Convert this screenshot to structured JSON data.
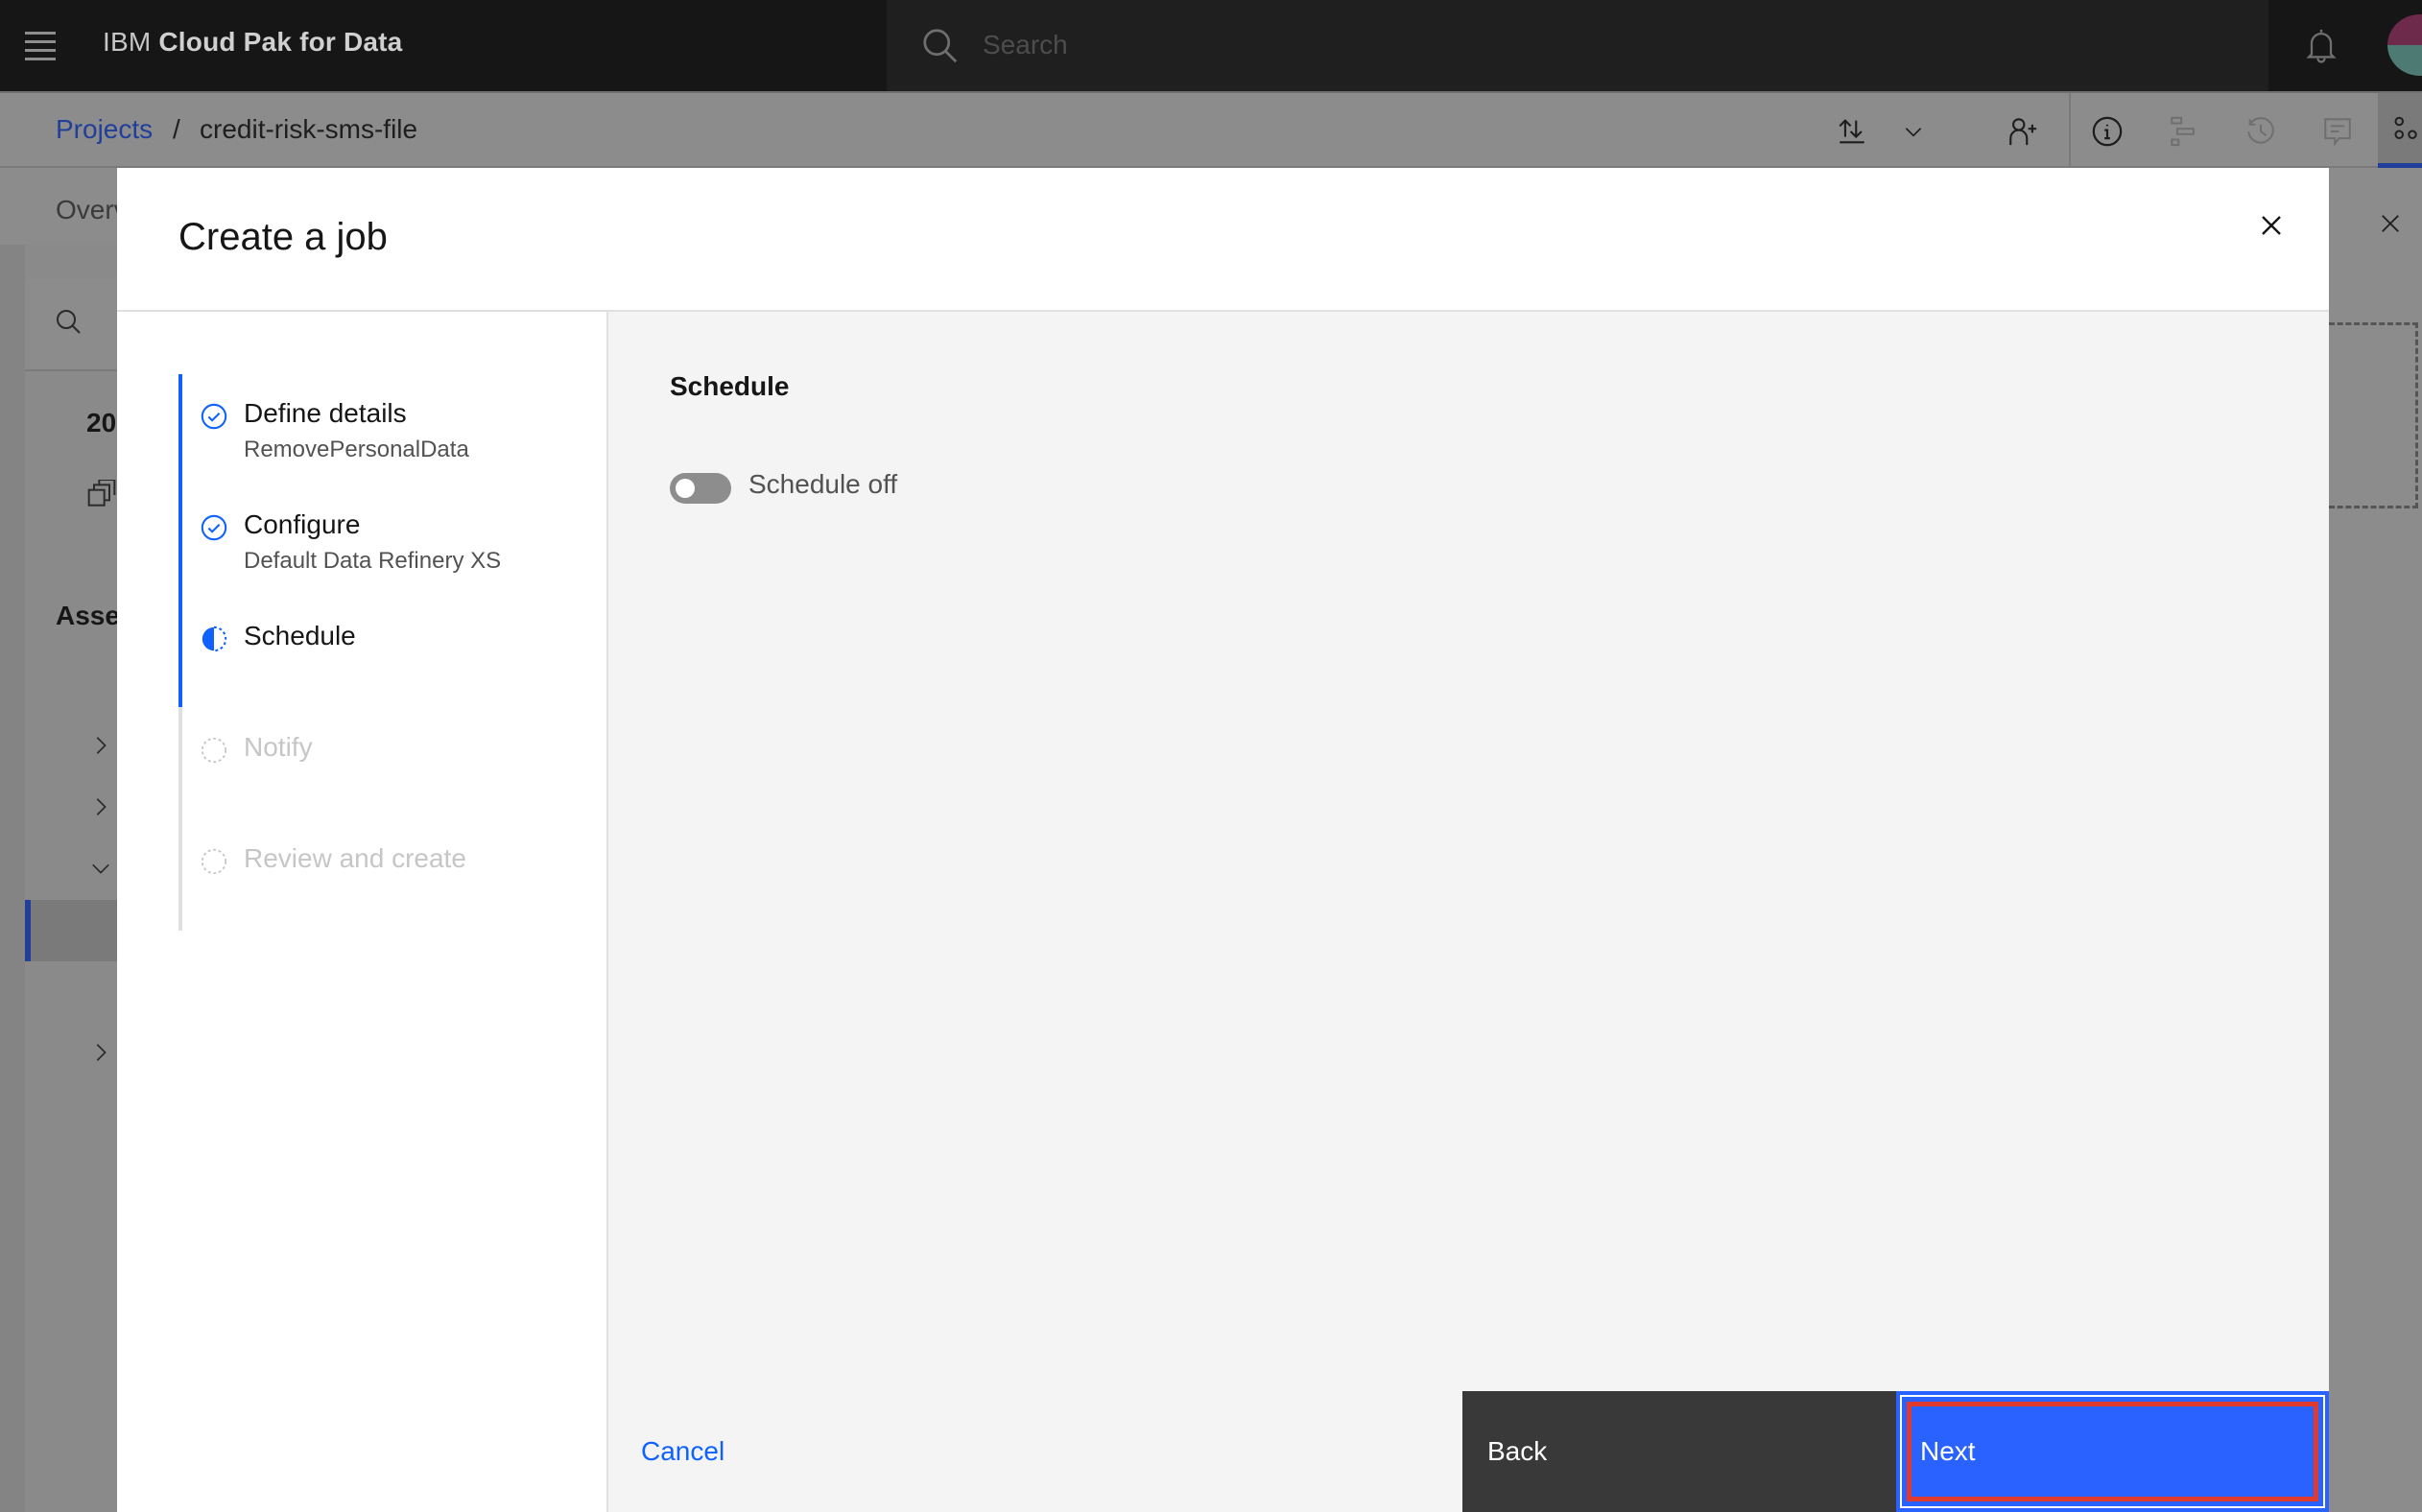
{
  "header": {
    "brand_prefix": "IBM",
    "brand_name": "Cloud Pak for Data",
    "search_placeholder": "Search",
    "icons": [
      "menu-icon",
      "search-icon",
      "notification-bell-icon",
      "user-avatar"
    ]
  },
  "breadcrumb": {
    "root": "Projects",
    "separator": "/",
    "current": "credit-risk-sms-file"
  },
  "toolbar": {
    "icons": [
      "import-export-icon",
      "chevron-down-icon",
      "add-collaborator-icon",
      "info-icon",
      "jobs-icon",
      "history-icon",
      "comments-icon",
      "apps-icon"
    ]
  },
  "background_page": {
    "tab_partial": "Overv",
    "count_partial": "20",
    "assets_partial": "Asse"
  },
  "modal": {
    "title": "Create a job",
    "steps": [
      {
        "label": "Define details",
        "sub": "RemovePersonalData",
        "state": "complete"
      },
      {
        "label": "Configure",
        "sub": "Default Data Refinery XS",
        "state": "complete"
      },
      {
        "label": "Schedule",
        "sub": "",
        "state": "current"
      },
      {
        "label": "Notify",
        "sub": "",
        "state": "incomplete"
      },
      {
        "label": "Review and create",
        "sub": "",
        "state": "incomplete"
      }
    ],
    "section_title": "Schedule",
    "schedule_toggle": {
      "label": "Schedule off",
      "on": false
    },
    "footer": {
      "cancel": "Cancel",
      "back": "Back",
      "next": "Next"
    }
  },
  "colors": {
    "accent": "#0f62fe",
    "highlight": "#e03a2e"
  }
}
